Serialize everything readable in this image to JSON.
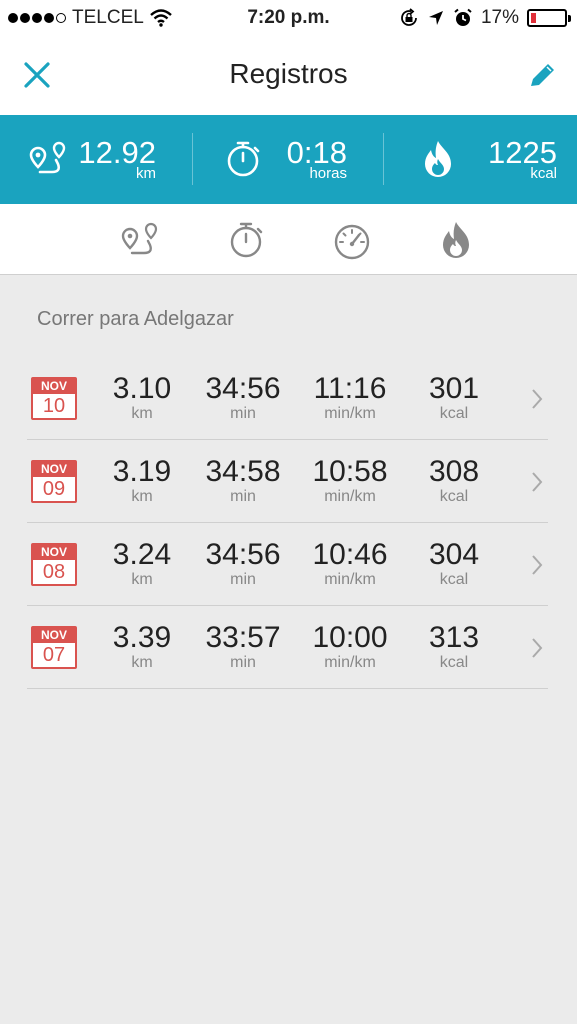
{
  "status": {
    "carrier": "TELCEL",
    "time": "7:20 p.m.",
    "battery_pct": "17%",
    "battery_level": 0.17,
    "signal_bars": 4,
    "signal_total": 5
  },
  "header": {
    "title": "Registros",
    "close_icon": "close-icon",
    "edit_icon": "pencil-icon"
  },
  "summary": {
    "distance": {
      "value": "12.92",
      "unit": "km",
      "icon": "route-icon"
    },
    "duration": {
      "value": "0:18",
      "unit": "horas",
      "icon": "stopwatch-icon"
    },
    "calories": {
      "value": "1225",
      "unit": "kcal",
      "icon": "flame-icon"
    }
  },
  "tabs": [
    {
      "icon": "route-icon"
    },
    {
      "icon": "stopwatch-icon"
    },
    {
      "icon": "speedometer-icon"
    },
    {
      "icon": "flame-icon"
    }
  ],
  "colors": {
    "accent": "#1aa3bf",
    "calendar": "#d9534f",
    "tab_icons": "#888888"
  },
  "section": {
    "title": "Correr para Adelgazar"
  },
  "records": [
    {
      "month": "NOV",
      "day": "10",
      "distance": "3.10",
      "distance_unit": "km",
      "time": "34:56",
      "time_unit": "min",
      "pace": "11:16",
      "pace_unit": "min/km",
      "calories": "301",
      "calories_unit": "kcal"
    },
    {
      "month": "NOV",
      "day": "09",
      "distance": "3.19",
      "distance_unit": "km",
      "time": "34:58",
      "time_unit": "min",
      "pace": "10:58",
      "pace_unit": "min/km",
      "calories": "308",
      "calories_unit": "kcal"
    },
    {
      "month": "NOV",
      "day": "08",
      "distance": "3.24",
      "distance_unit": "km",
      "time": "34:56",
      "time_unit": "min",
      "pace": "10:46",
      "pace_unit": "min/km",
      "calories": "304",
      "calories_unit": "kcal"
    },
    {
      "month": "NOV",
      "day": "07",
      "distance": "3.39",
      "distance_unit": "km",
      "time": "33:57",
      "time_unit": "min",
      "pace": "10:00",
      "pace_unit": "min/km",
      "calories": "313",
      "calories_unit": "kcal"
    }
  ]
}
